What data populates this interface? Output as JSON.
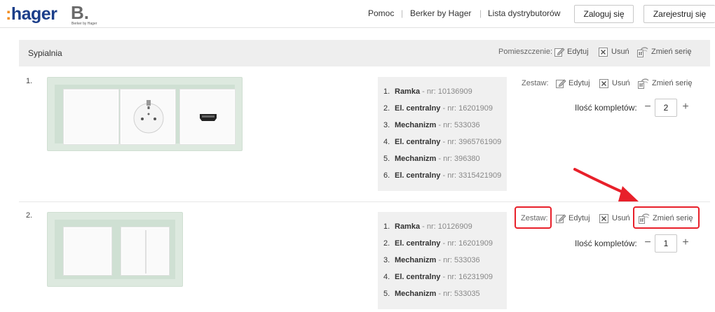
{
  "header": {
    "nav": [
      "Pomoc",
      "Berker by Hager",
      "Lista dystrybutorów"
    ],
    "login_label": "Zaloguj się",
    "register_label": "Zarejestruj się",
    "berker_sub": "Berker by Hager"
  },
  "room": {
    "title": "Sypialnia",
    "label": "Pomieszczenie:",
    "edit": "Edytuj",
    "delete": "Usuń",
    "change": "Zmień serię"
  },
  "sets": [
    {
      "number": "1.",
      "label": "Zestaw:",
      "edit": "Edytuj",
      "delete": "Usuń",
      "change": "Zmień serię",
      "qty_label": "Ilość kompletów:",
      "qty": "2",
      "items": [
        {
          "idx": "1.",
          "name": "Ramka",
          "nr": " - nr: 10136909"
        },
        {
          "idx": "2.",
          "name": "El. centralny",
          "nr": " - nr: 16201909"
        },
        {
          "idx": "3.",
          "name": "Mechanizm",
          "nr": " - nr: 533036"
        },
        {
          "idx": "4.",
          "name": "El. centralny",
          "nr": " - nr: 3965761909"
        },
        {
          "idx": "5.",
          "name": "Mechanizm",
          "nr": " - nr: 396380"
        },
        {
          "idx": "6.",
          "name": "El. centralny",
          "nr": " - nr: 3315421909"
        }
      ]
    },
    {
      "number": "2.",
      "label": "Zestaw:",
      "edit": "Edytuj",
      "delete": "Usuń",
      "change": "Zmień serię",
      "qty_label": "Ilość kompletów:",
      "qty": "1",
      "items": [
        {
          "idx": "1.",
          "name": "Ramka",
          "nr": " - nr: 10126909"
        },
        {
          "idx": "2.",
          "name": "El. centralny",
          "nr": " - nr: 16201909"
        },
        {
          "idx": "3.",
          "name": "Mechanizm",
          "nr": " - nr: 533036"
        },
        {
          "idx": "4.",
          "name": "El. centralny",
          "nr": " - nr: 16231909"
        },
        {
          "idx": "5.",
          "name": "Mechanizm",
          "nr": " - nr: 533035"
        }
      ]
    }
  ],
  "colors": {
    "hager_blue": "#1b3e8a",
    "hager_orange": "#f28c1e",
    "annotation_red": "#e8202a"
  },
  "icons": [
    "edit-icon",
    "delete-icon",
    "change-series-icon",
    "annotation-arrow"
  ]
}
